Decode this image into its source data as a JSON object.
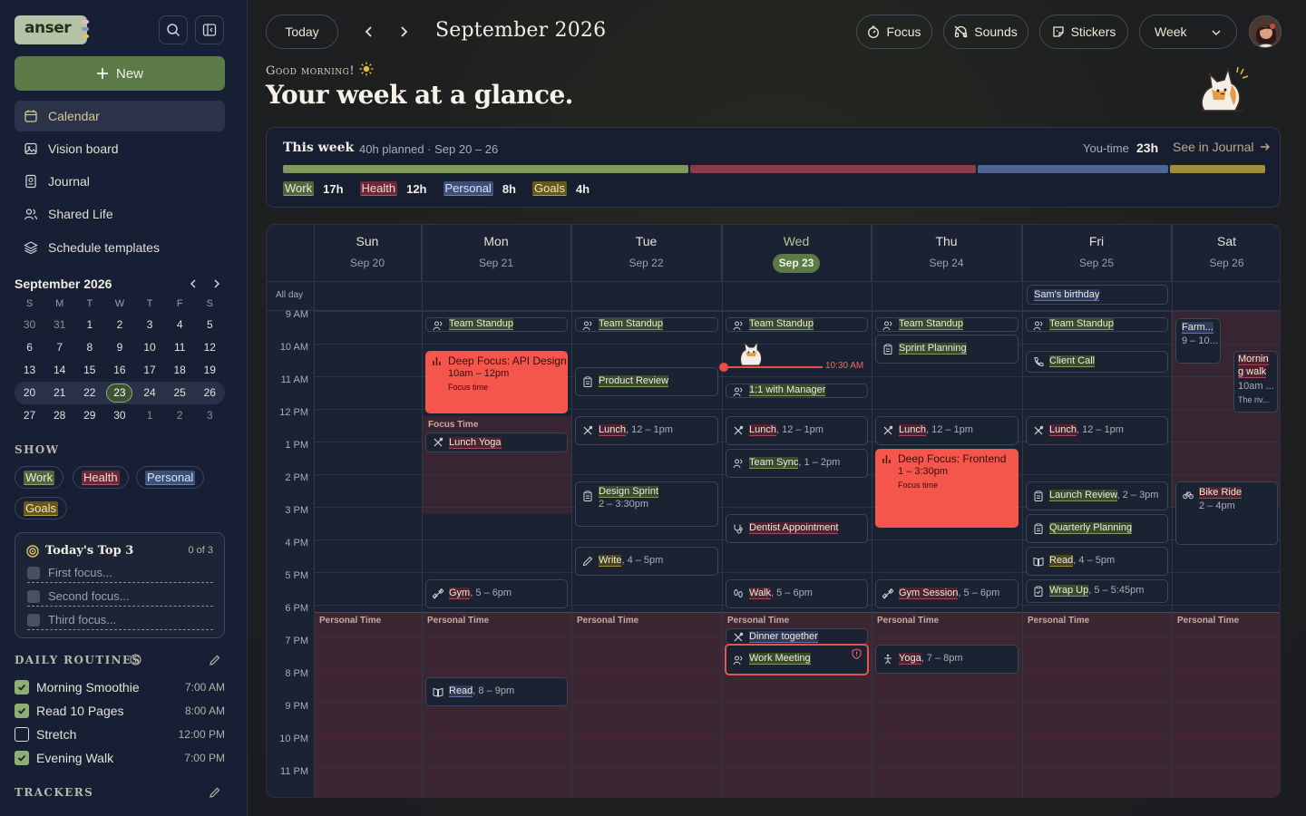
{
  "sidebar": {
    "logo": "anser",
    "new_label": "New",
    "nav": [
      "Calendar",
      "Vision board",
      "Journal",
      "Shared Life",
      "Schedule templates"
    ],
    "mini_calendar": {
      "title": "September 2026",
      "weekdays": [
        "S",
        "M",
        "T",
        "W",
        "T",
        "F",
        "S"
      ],
      "weeks": [
        [
          "30",
          "31",
          "1",
          "2",
          "3",
          "4",
          "5"
        ],
        [
          "6",
          "7",
          "8",
          "9",
          "10",
          "11",
          "12"
        ],
        [
          "13",
          "14",
          "15",
          "16",
          "17",
          "18",
          "19"
        ],
        [
          "20",
          "21",
          "22",
          "23",
          "24",
          "25",
          "26"
        ],
        [
          "27",
          "28",
          "29",
          "30",
          "1",
          "2",
          "3"
        ]
      ],
      "today": "23"
    },
    "show_title": "SHOW",
    "show_chips": [
      "Work",
      "Health",
      "Personal",
      "Goals"
    ],
    "top3": {
      "title": "Today's Top 3",
      "count": "0 of 3",
      "items": [
        "First focus...",
        "Second focus...",
        "Third focus..."
      ]
    },
    "routines_title": "DAILY ROUTINES",
    "routines": [
      {
        "name": "Morning Smoothie",
        "time": "7:00 AM",
        "done": true
      },
      {
        "name": "Read 10 Pages",
        "time": "8:00 AM",
        "done": true
      },
      {
        "name": "Stretch",
        "time": "12:00 PM",
        "done": false
      },
      {
        "name": "Evening Walk",
        "time": "7:00 PM",
        "done": true
      }
    ],
    "trackers_title": "TRACKERS"
  },
  "header": {
    "today_label": "Today",
    "title": "September 2026",
    "focus_label": "Focus",
    "sounds_label": "Sounds",
    "stickers_label": "Stickers",
    "view_label": "Week"
  },
  "greeting": {
    "small": "Good morning!",
    "headline": "Your week at a glance."
  },
  "week_summary": {
    "title": "This week",
    "subtitle": "40h planned · Sep 20 – 26",
    "you_time_label": "You-time",
    "you_time_value": "23h",
    "journal_link": "See in Journal",
    "categories": [
      {
        "name": "Work",
        "hours": "17h",
        "color": "#7e9a5e",
        "share": 17
      },
      {
        "name": "Health",
        "hours": "12h",
        "color": "#8c3b4a",
        "share": 12
      },
      {
        "name": "Personal",
        "hours": "8h",
        "color": "#4f6592",
        "share": 8
      },
      {
        "name": "Goals",
        "hours": "4h",
        "color": "#a28d3a",
        "share": 4
      }
    ]
  },
  "calendar": {
    "days": [
      {
        "name": "Sun",
        "date": "Sep 20"
      },
      {
        "name": "Mon",
        "date": "Sep 21"
      },
      {
        "name": "Tue",
        "date": "Sep 22"
      },
      {
        "name": "Wed",
        "date": "Sep 23"
      },
      {
        "name": "Thu",
        "date": "Sep 24"
      },
      {
        "name": "Fri",
        "date": "Sep 25"
      },
      {
        "name": "Sat",
        "date": "Sep 26"
      }
    ],
    "allday_label": "All day",
    "hours": [
      "9 AM",
      "10 AM",
      "11 AM",
      "12 PM",
      "1 PM",
      "2 PM",
      "3 PM",
      "4 PM",
      "5 PM",
      "6 PM",
      "7 PM",
      "8 PM",
      "9 PM",
      "10 PM",
      "11 PM"
    ],
    "now_label": "10:30 AM",
    "focus_time_label": "Focus Time",
    "personal_time_label": "Personal Time",
    "events": {
      "birthday": "Sam's birthday",
      "mon_standup": "Team Standup",
      "mon_deep_title": "Deep Focus: API Design",
      "mon_deep_time": "10am – 12pm",
      "mon_deep_sub": "Focus time",
      "mon_yoga": "Lunch Yoga",
      "mon_gym": "Gym",
      "mon_gym_time": ", 5 – 6pm",
      "mon_read": "Read",
      "mon_read_time": ", 8 – 9pm",
      "tue_standup": "Team Standup",
      "tue_review": "Product Review",
      "tue_lunch": "Lunch",
      "tue_lunch_time": ", 12 – 1pm",
      "tue_sprint": "Design Sprint",
      "tue_sprint_time": "2 – 3:30pm",
      "tue_write": "Write",
      "tue_write_time": ", 4 – 5pm",
      "wed_standup": "Team Standup",
      "wed_one": "1:1 with Manager",
      "wed_lunch": "Lunch",
      "wed_lunch_time": ", 12 – 1pm",
      "wed_sync": "Team Sync",
      "wed_sync_time": ", 1 – 2pm",
      "wed_dentist": "Dentist Appointment",
      "wed_walk": "Walk",
      "wed_walk_time": ", 5 – 6pm",
      "wed_dinner": "Dinner together",
      "wed_meeting": "Work Meeting",
      "thu_standup": "Team Standup",
      "thu_sprint": "Sprint Planning",
      "thu_lunch": "Lunch",
      "thu_lunch_time": ", 12 – 1pm",
      "thu_deep_title": "Deep Focus: Frontend",
      "thu_deep_time": "1 – 3:30pm",
      "thu_deep_sub": "Focus time",
      "thu_gym": "Gym Session",
      "thu_gym_time": ", 5 – 6pm",
      "thu_yoga": "Yoga",
      "thu_yoga_time": ", 7 – 8pm",
      "fri_standup": "Team Standup",
      "fri_client": "Client Call",
      "fri_lunch": "Lunch",
      "fri_lunch_time": ", 12 – 1pm",
      "fri_launch": "Launch Review",
      "fri_launch_time": ", 2 – 3pm",
      "fri_quarter": "Quarterly Planning",
      "fri_read": "Read",
      "fri_read_time": ", 4 – 5pm",
      "fri_wrap": "Wrap Up",
      "fri_wrap_time": ", 5 – 5:45pm",
      "sat_farm": "Farm...",
      "sat_farm_time": "9 – 10...",
      "sat_walk_a": "Mornin",
      "sat_walk_b": "g walk",
      "sat_walk_time": "10am ...",
      "sat_walk_sub": "The riv...",
      "sat_bike": "Bike Ride",
      "sat_bike_time": "2 – 4pm"
    }
  }
}
